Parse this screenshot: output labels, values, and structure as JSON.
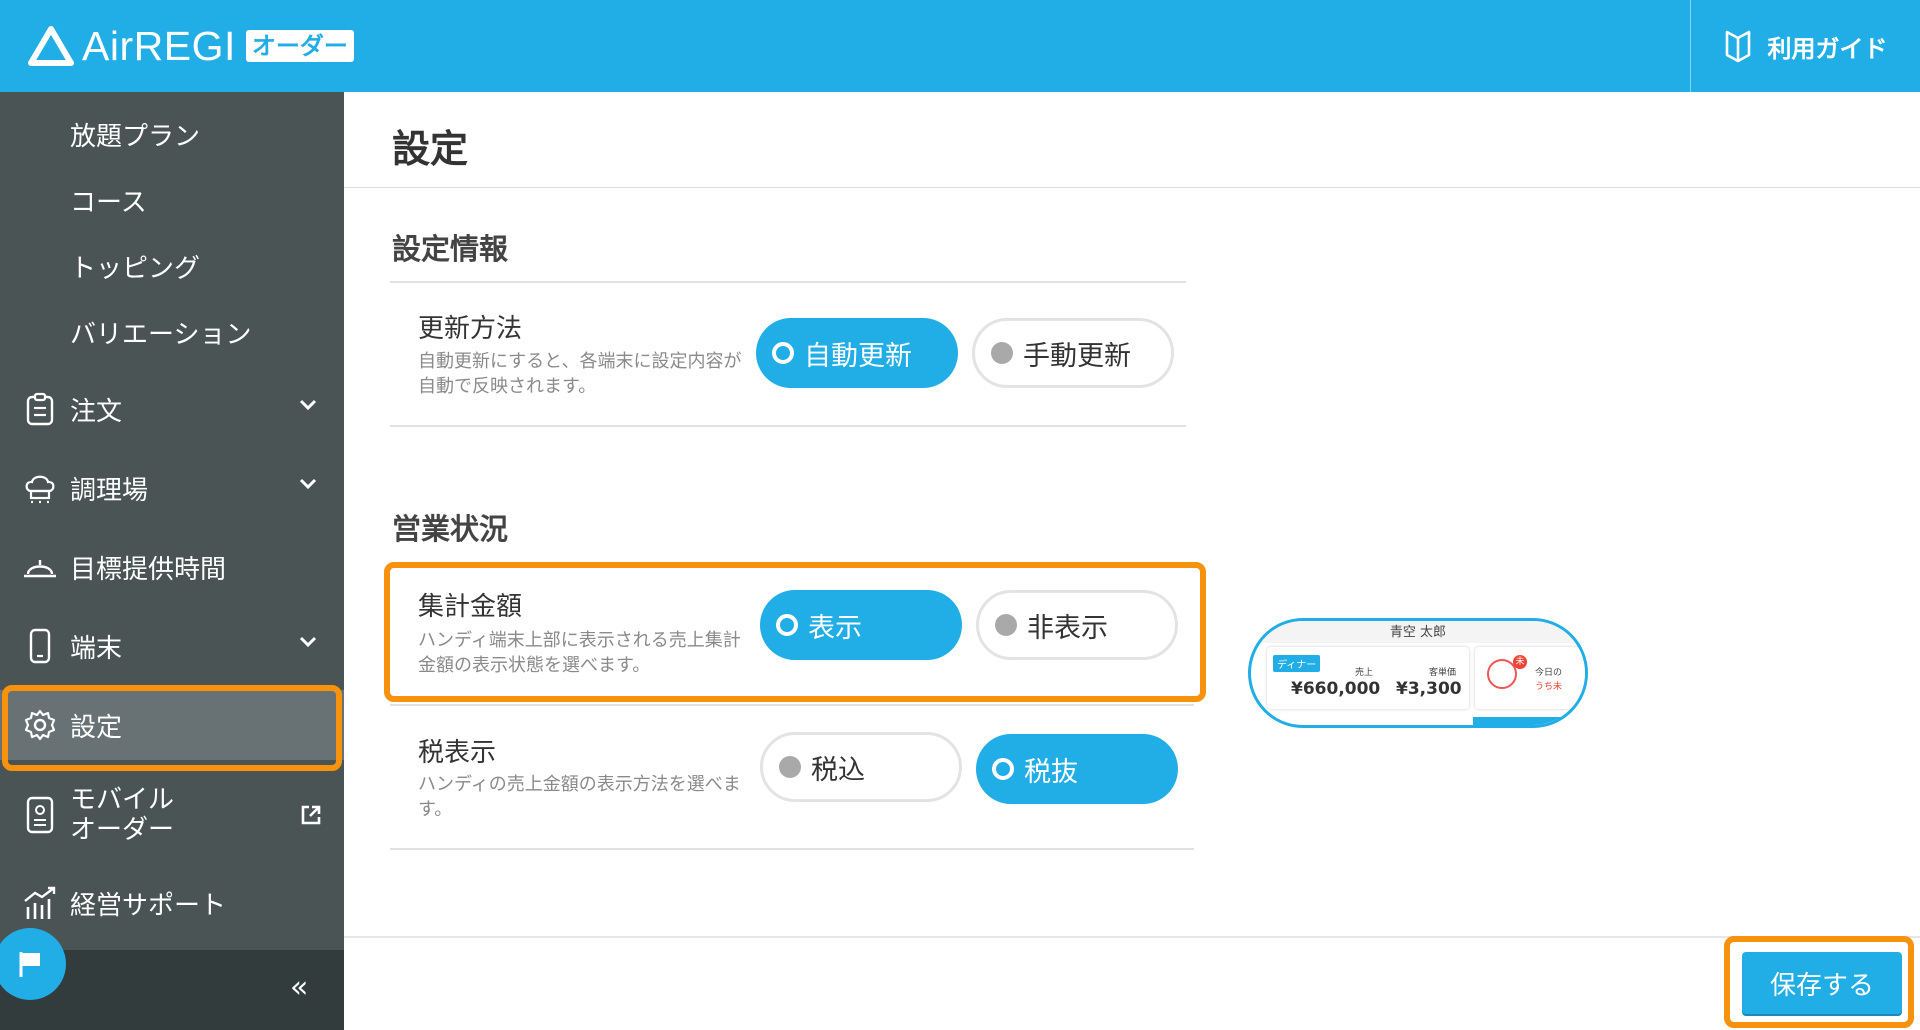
{
  "header": {
    "logo_text": "AirREGI",
    "logo_badge": "オーダー",
    "guide_label": "利用ガイド"
  },
  "sidebar": {
    "sub_items": [
      "放題プラン",
      "コース",
      "トッピング",
      "バリエーション"
    ],
    "items": [
      {
        "label": "注文",
        "icon": "clipboard-icon",
        "has_chevron": true
      },
      {
        "label": "調理場",
        "icon": "chef-hat-icon",
        "has_chevron": true
      },
      {
        "label": "目標提供時間",
        "icon": "cloche-icon",
        "has_chevron": false
      },
      {
        "label": "端末",
        "icon": "smartphone-icon",
        "has_chevron": true
      },
      {
        "label": "設定",
        "icon": "gear-icon",
        "has_chevron": false,
        "active": true
      },
      {
        "label_line1": "モバイル",
        "label_line2": "オーダー",
        "icon": "mobile-order-icon",
        "external": true
      },
      {
        "label": "経営サポート",
        "icon": "chart-icon",
        "has_chevron": false
      }
    ],
    "collapse_label": "«"
  },
  "main": {
    "page_title": "設定",
    "sections": [
      {
        "title": "設定情報",
        "rows": [
          {
            "label": "更新方法",
            "desc": "自動更新にすると、各端末に設定内容が自動で反映されます。",
            "options": [
              "自動更新",
              "手動更新"
            ],
            "selected": 0
          }
        ]
      },
      {
        "title": "営業状況",
        "rows": [
          {
            "label": "集計金額",
            "desc": "ハンディ端末上部に表示される売上集計金額の表示状態を選べます。",
            "options": [
              "表示",
              "非表示"
            ],
            "selected": 0
          },
          {
            "label": "税表示",
            "desc": "ハンディの売上金額の表示方法を選べます。",
            "options": [
              "税込",
              "税抜"
            ],
            "selected": 1
          }
        ]
      }
    ],
    "preview": {
      "top_text": "青空 太郎",
      "tag": "ディナー",
      "sales_label": "売上",
      "sales_value": "¥660,000",
      "avg_label": "客単価",
      "avg_value": "¥3,300",
      "badge": "未",
      "today_label": "今日の",
      "unsettled_label": "うち未"
    },
    "save_label": "保存する"
  },
  "colors": {
    "brand_blue": "#21ade5",
    "highlight_orange": "#f7920d",
    "sidebar_bg": "#4a5455"
  }
}
